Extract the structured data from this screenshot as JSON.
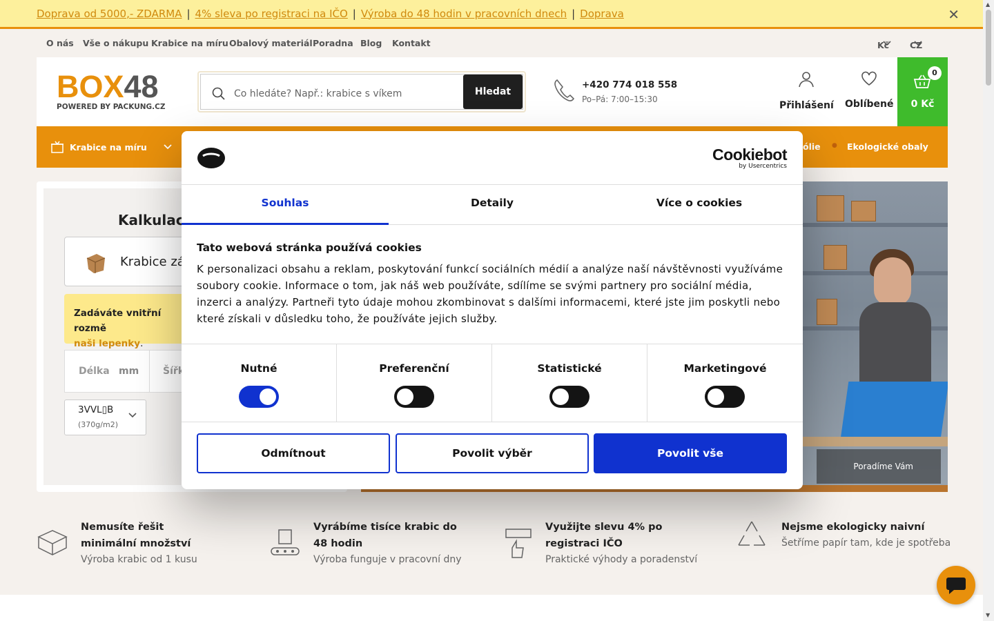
{
  "promo_bar": {
    "items": [
      "Doprava od 5000,- ZDARMA",
      "4% sleva po registraci na IČO",
      "Výroba do 48 hodin v pracovních dnech",
      "Doprava"
    ],
    "separator": "|",
    "close": "✕"
  },
  "secondary_nav": {
    "items": [
      "O nás",
      "Vše o nákupu",
      "Krabice na míru",
      "Obalový materiál",
      "Poradna",
      "Blog",
      "Kontakt"
    ],
    "currency": "Kč",
    "language": "CZ"
  },
  "header": {
    "logo_main_a": "BOX",
    "logo_main_b": "48",
    "logo_sub": "POWERED BY PACKUNG.CZ",
    "search_placeholder": "Co hledáte? Např.: krabice s víkem",
    "search_button": "Hledat",
    "phone": "+420 774 018 558",
    "hours": "Po–Pá: 7:00–15:30",
    "login": "Přihlášení",
    "favorites": "Oblíbené",
    "cart_count": "0",
    "cart_price": "0 Kč"
  },
  "category_bar": {
    "first": "Krabice na míru",
    "partial": "ólie",
    "last": "Ekologické obaly"
  },
  "calculator": {
    "title": "Kalkulace k",
    "box_type": "Krabice zás",
    "note_bold": "Zadáváte vnitřní rozmě",
    "note_link": "naši lepenky",
    "note_tail": ".",
    "length_label": "Délka",
    "unit": "mm",
    "width_label": "Šířk",
    "material": "3VVL▯B",
    "material_weight": "(370g/m2)"
  },
  "hero": {
    "caption": "Poradíme Vám"
  },
  "usps": [
    {
      "title": "Nemusíte řešit minimální množství",
      "desc": "Výroba krabic od 1 kusu",
      "icon": "box-icon"
    },
    {
      "title": "Vyrábíme tisíce krabic do 48 hodin",
      "desc": "Výroba funguje v pracovní dny",
      "icon": "factory-icon"
    },
    {
      "title": "Využijte slevu 4% po registraci IČO",
      "desc": "Praktické výhody a poradenství",
      "icon": "rating-thumb-icon"
    },
    {
      "title": "Nejsme ekologicky naivní",
      "desc": "Šetříme papír tam, kde je spotřeba",
      "icon": "recycle-icon"
    }
  ],
  "cookie": {
    "brand_a": "Cookiebot",
    "brand_b": "by Usercentrics",
    "tabs": [
      "Souhlas",
      "Detaily",
      "Více o cookies"
    ],
    "heading": "Tato webová stránka používá cookies",
    "text": "K personalizaci obsahu a reklam, poskytování funkcí sociálních médií a analýze naší návštěvnosti využíváme soubory cookie. Informace o tom, jak náš web používáte, sdílíme se svými partnery pro sociální média, inzerci a analýzy. Partneři tyto údaje mohou zkombinovat s dalšími informacemi, které jste jim poskytli nebo které získali v důsledku toho, že používáte jejich služby.",
    "categories": [
      {
        "name": "Nutné",
        "enabled": true
      },
      {
        "name": "Preferenční",
        "enabled": false
      },
      {
        "name": "Statistické",
        "enabled": false
      },
      {
        "name": "Marketingové",
        "enabled": false
      }
    ],
    "buttons": [
      "Odmítnout",
      "Povolit výběr",
      "Povolit vše"
    ],
    "accent": "#1032cf"
  },
  "colors": {
    "brand_orange": "#e8900c",
    "cart_green": "#3fbb2c",
    "promo_yellow": "#fdf09c"
  }
}
